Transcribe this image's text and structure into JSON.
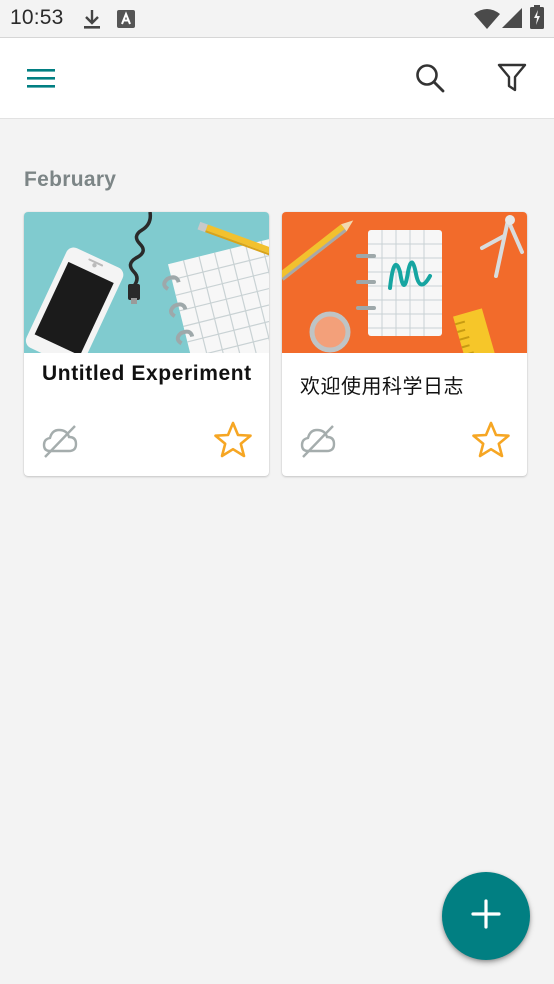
{
  "status_bar": {
    "time": "10:53",
    "icons": [
      "download-icon",
      "font-notification-icon",
      "wifi-icon",
      "cellular-signal-icon",
      "battery-charging-icon"
    ]
  },
  "app_bar": {
    "menu_icon": "menu-icon",
    "search_icon": "search-icon",
    "filter_icon": "filter-icon",
    "accent_color": "#017f82"
  },
  "section": {
    "title": "February"
  },
  "experiments": [
    {
      "title": "Untitled Experiment",
      "thumbnail": "phone-and-notebook-illustration",
      "archived_icon": "cloud-off-icon",
      "starred_icon": "star-outline-icon",
      "thumb_bg": "#80cbcf"
    },
    {
      "title": "欢迎使用科学日志",
      "thumbnail": "science-notebook-illustration",
      "archived_icon": "cloud-off-icon",
      "starred_icon": "star-outline-icon",
      "thumb_bg": "#f26b2b"
    }
  ],
  "fab": {
    "icon": "add-icon",
    "color": "#017f82"
  },
  "colors": {
    "star": "#f6a623",
    "icon_gray": "#a5adad",
    "background": "#f3f3f3"
  }
}
